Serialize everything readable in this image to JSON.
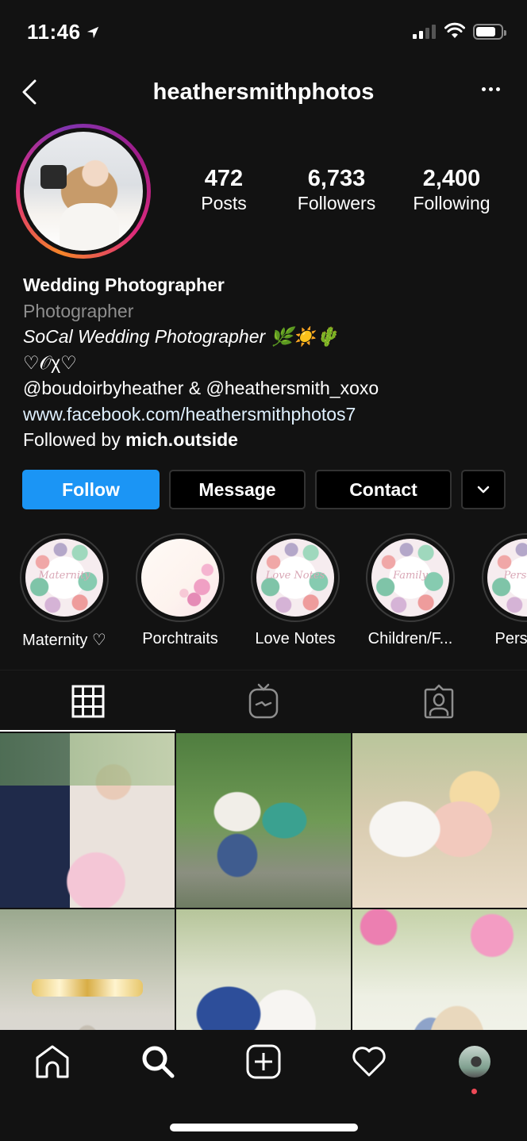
{
  "status_bar": {
    "time": "11:46",
    "location_icon": "location-arrow-icon",
    "signal_bars_active": 2,
    "signal_bars_total": 4,
    "wifi_icon": "wifi-icon",
    "battery_level_percent": 80
  },
  "header": {
    "back_icon": "chevron-left-icon",
    "username": "heathersmithphotos",
    "more_icon": "more-horizontal-icon"
  },
  "profile": {
    "story_ring_colors": [
      "#f58529",
      "#dd2a7b",
      "#8134af"
    ],
    "stats": [
      {
        "value": "472",
        "label": "Posts"
      },
      {
        "value": "6,733",
        "label": "Followers"
      },
      {
        "value": "2,400",
        "label": "Following"
      }
    ],
    "bio": {
      "name": "Wedding Photographer",
      "category": "Photographer",
      "line1": "SoCal Wedding Photographer 🌿☀️🌵",
      "line2": "♡𝒪χ♡",
      "line3": "@boudoirbyheather & @heathersmith_xoxo",
      "website": "www.facebook.com/heathersmithphotos7",
      "followed_by_prefix": "Followed by ",
      "followed_by_user": "mich.outside"
    }
  },
  "actions": {
    "follow": "Follow",
    "message": "Message",
    "contact": "Contact",
    "more_icon": "chevron-down-icon",
    "follow_color": "#1b95f5"
  },
  "highlights": [
    {
      "label": "Maternity ♡",
      "cover_text": "Maternity"
    },
    {
      "label": "Porchtraits",
      "cover_text": ""
    },
    {
      "label": "Love Notes",
      "cover_text": "Love Notes"
    },
    {
      "label": "Children/F...",
      "cover_text": "Family"
    },
    {
      "label": "Personal",
      "cover_text": "Personal"
    }
  ],
  "tabs": [
    {
      "name": "grid",
      "icon": "grid-icon",
      "active": true
    },
    {
      "name": "igtv",
      "icon": "igtv-icon",
      "active": false
    },
    {
      "name": "tagged",
      "icon": "tagged-person-icon",
      "active": false
    }
  ],
  "posts": [
    {
      "description": "Bride with groom in navy suit holding bouquet"
    },
    {
      "description": "Couple kissing on log in garden, woman in teal dress"
    },
    {
      "description": "Couple embracing in golden light, woman in pink lace"
    },
    {
      "description": "Wedding rings on stone"
    },
    {
      "description": "Groom in blue suit and bride holding hands"
    },
    {
      "description": "Couple embracing under pink blossoms"
    }
  ],
  "bottom_nav": [
    {
      "name": "home",
      "icon": "home-icon"
    },
    {
      "name": "search",
      "icon": "search-icon"
    },
    {
      "name": "new-post",
      "icon": "add-square-icon"
    },
    {
      "name": "activity",
      "icon": "heart-icon"
    },
    {
      "name": "profile",
      "icon": "profile-avatar",
      "notification_dot": true
    }
  ]
}
